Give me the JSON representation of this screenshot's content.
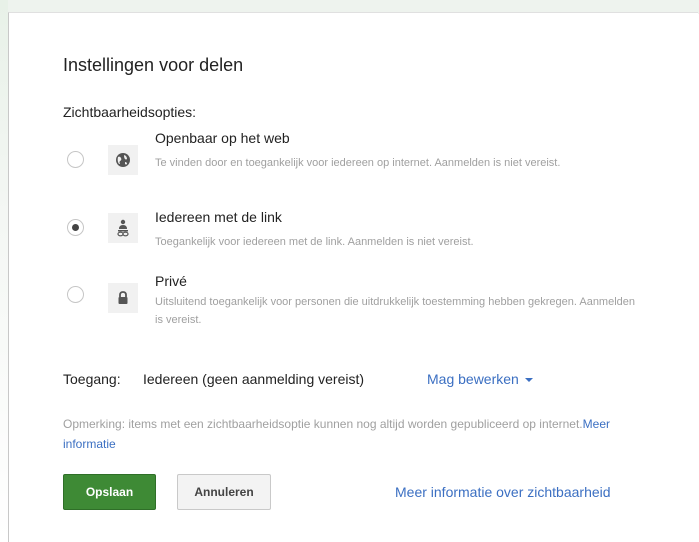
{
  "dialog": {
    "title": "Instellingen voor delen",
    "visibility_label": "Zichtbaarheidsopties:",
    "options": [
      {
        "icon": "globe-icon",
        "title": "Openbaar op het web",
        "description": "Te vinden door en toegankelijk voor iedereen op internet. Aanmelden is niet vereist.",
        "selected": false
      },
      {
        "icon": "person-link-icon",
        "title": "Iedereen met de link",
        "description": "Toegankelijk voor iedereen met de link. Aanmelden is niet vereist.",
        "selected": true
      },
      {
        "icon": "lock-icon",
        "title": "Privé",
        "description": "Uitsluitend toegankelijk voor personen die uitdrukkelijk toestemming hebben gekregen. Aanmelden is vereist.",
        "selected": false
      }
    ],
    "access": {
      "label": "Toegang:",
      "value": "Iedereen (geen aanmelding vereist)",
      "dropdown": "Mag bewerken"
    },
    "note": {
      "text": "Opmerking: items met een zichtbaarheidsoptie kunnen nog altijd worden gepubliceerd op internet.",
      "link": "Meer informatie"
    },
    "buttons": {
      "save": "Opslaan",
      "cancel": "Annuleren"
    },
    "more_info_link": "Meer informatie over zichtbaarheid"
  },
  "colors": {
    "primary_button": "#3e8a35",
    "link": "#3b6fc2"
  }
}
